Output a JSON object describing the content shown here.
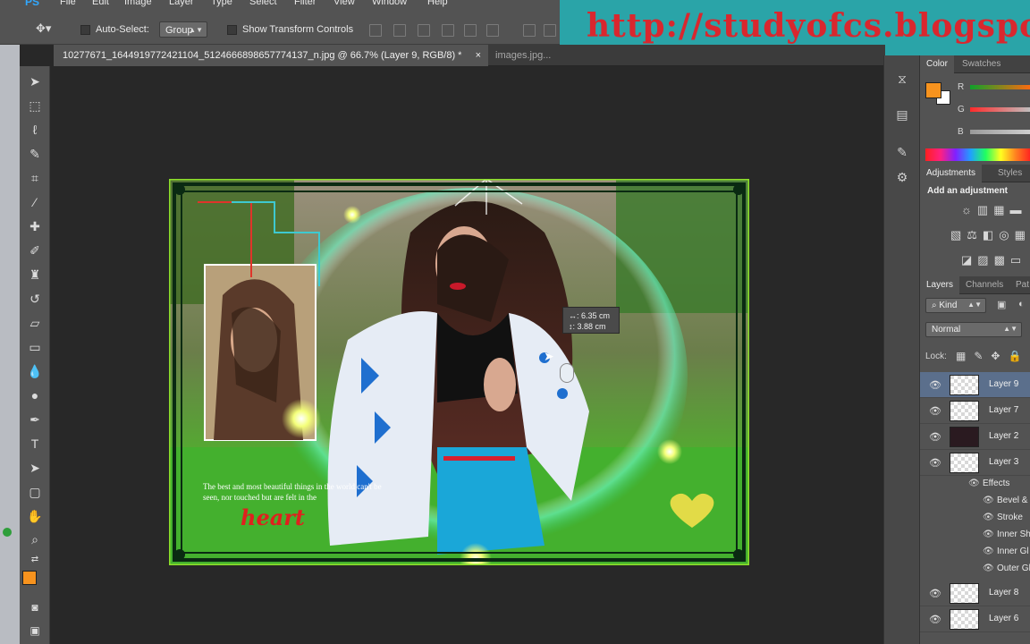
{
  "app": {
    "logo": "PS"
  },
  "menu": [
    "File",
    "Edit",
    "Image",
    "Layer",
    "Type",
    "Select",
    "Filter",
    "View",
    "Window",
    "Help"
  ],
  "options": {
    "auto_select_label": "Auto-Select:",
    "auto_select_value": "Group",
    "show_transform_label": "Show Transform Controls"
  },
  "tabs": [
    {
      "label": "10277671_1644919772421104_5124666898657774137_n.jpg @ 66.7% (Layer 9, RGB/8) *",
      "close": "×"
    },
    {
      "label": "images.jpg..."
    }
  ],
  "watermark": {
    "text": "http://studyofcs.blogspot."
  },
  "tooltip": {
    "width": "↔: 6.35 cm",
    "height": "↕: 3.88 cm"
  },
  "artwork": {
    "caption_text": "The best and most beautiful things in the world can't be seen, nor touched but are felt in the",
    "caption_word": "heart"
  },
  "color_panel": {
    "tabs": [
      "Color",
      "Swatches"
    ],
    "channels": [
      "R",
      "G",
      "B"
    ],
    "foreground": "#f7931e",
    "background": "#ffffff"
  },
  "adjustments_panel": {
    "tabs": [
      "Adjustments",
      "Styles"
    ],
    "heading": "Add an adjustment"
  },
  "layers_panel": {
    "tabs": [
      "Layers",
      "Channels",
      "Pat"
    ],
    "filter_kind": "Kind",
    "blend_mode": "Normal",
    "lock_label": "Lock:",
    "layers": [
      {
        "name": "Layer 9",
        "selected": true
      },
      {
        "name": "Layer 7"
      },
      {
        "name": "Layer 2"
      },
      {
        "name": "Layer 3"
      }
    ],
    "effects_label": "Effects",
    "effects": [
      "Bevel &",
      "Stroke",
      "Inner Sh",
      "Inner Gl",
      "Outer Gl"
    ],
    "layers_below": [
      {
        "name": "Layer 8"
      },
      {
        "name": "Layer 6"
      }
    ]
  },
  "colors": {
    "accent_orange": "#f7931e",
    "selection_blue": "#5b6f8c",
    "watermark_bg": "#2aa4a8",
    "watermark_text": "#d9272e"
  }
}
